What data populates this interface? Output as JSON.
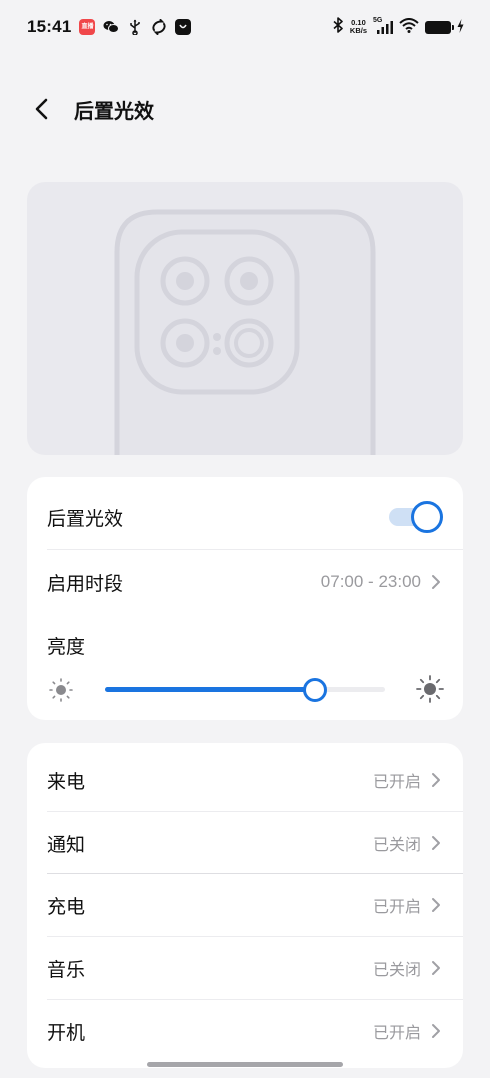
{
  "status_bar": {
    "time": "15:41",
    "net_speed_value": "0.10",
    "net_speed_unit": "KB/s",
    "network_type": "5G",
    "app_icons": [
      "video-app-icon",
      "wechat-icon",
      "usb-icon",
      "sync-app-icon",
      "bag-app-icon"
    ],
    "app_icon_labels": {
      "video": "直播"
    }
  },
  "header": {
    "title": "后置光效"
  },
  "settings": {
    "rear_light": {
      "label": "后置光效",
      "enabled": true
    },
    "schedule": {
      "label": "启用时段",
      "value": "07:00 - 23:00"
    },
    "brightness": {
      "label": "亮度",
      "level": 0.75
    }
  },
  "notifications_list": {
    "items": [
      {
        "label": "来电",
        "value": "已开启"
      },
      {
        "label": "通知",
        "value": "已关闭"
      },
      {
        "label": "充电",
        "value": "已开启"
      },
      {
        "label": "音乐",
        "value": "已关闭"
      },
      {
        "label": "开机",
        "value": "已开启"
      }
    ]
  },
  "colors": {
    "accent": "#1a74e0",
    "background": "#f3f3f5",
    "card": "#ffffff",
    "preview_bg": "#e9e9ee",
    "secondary_text": "#9a9a9e"
  }
}
